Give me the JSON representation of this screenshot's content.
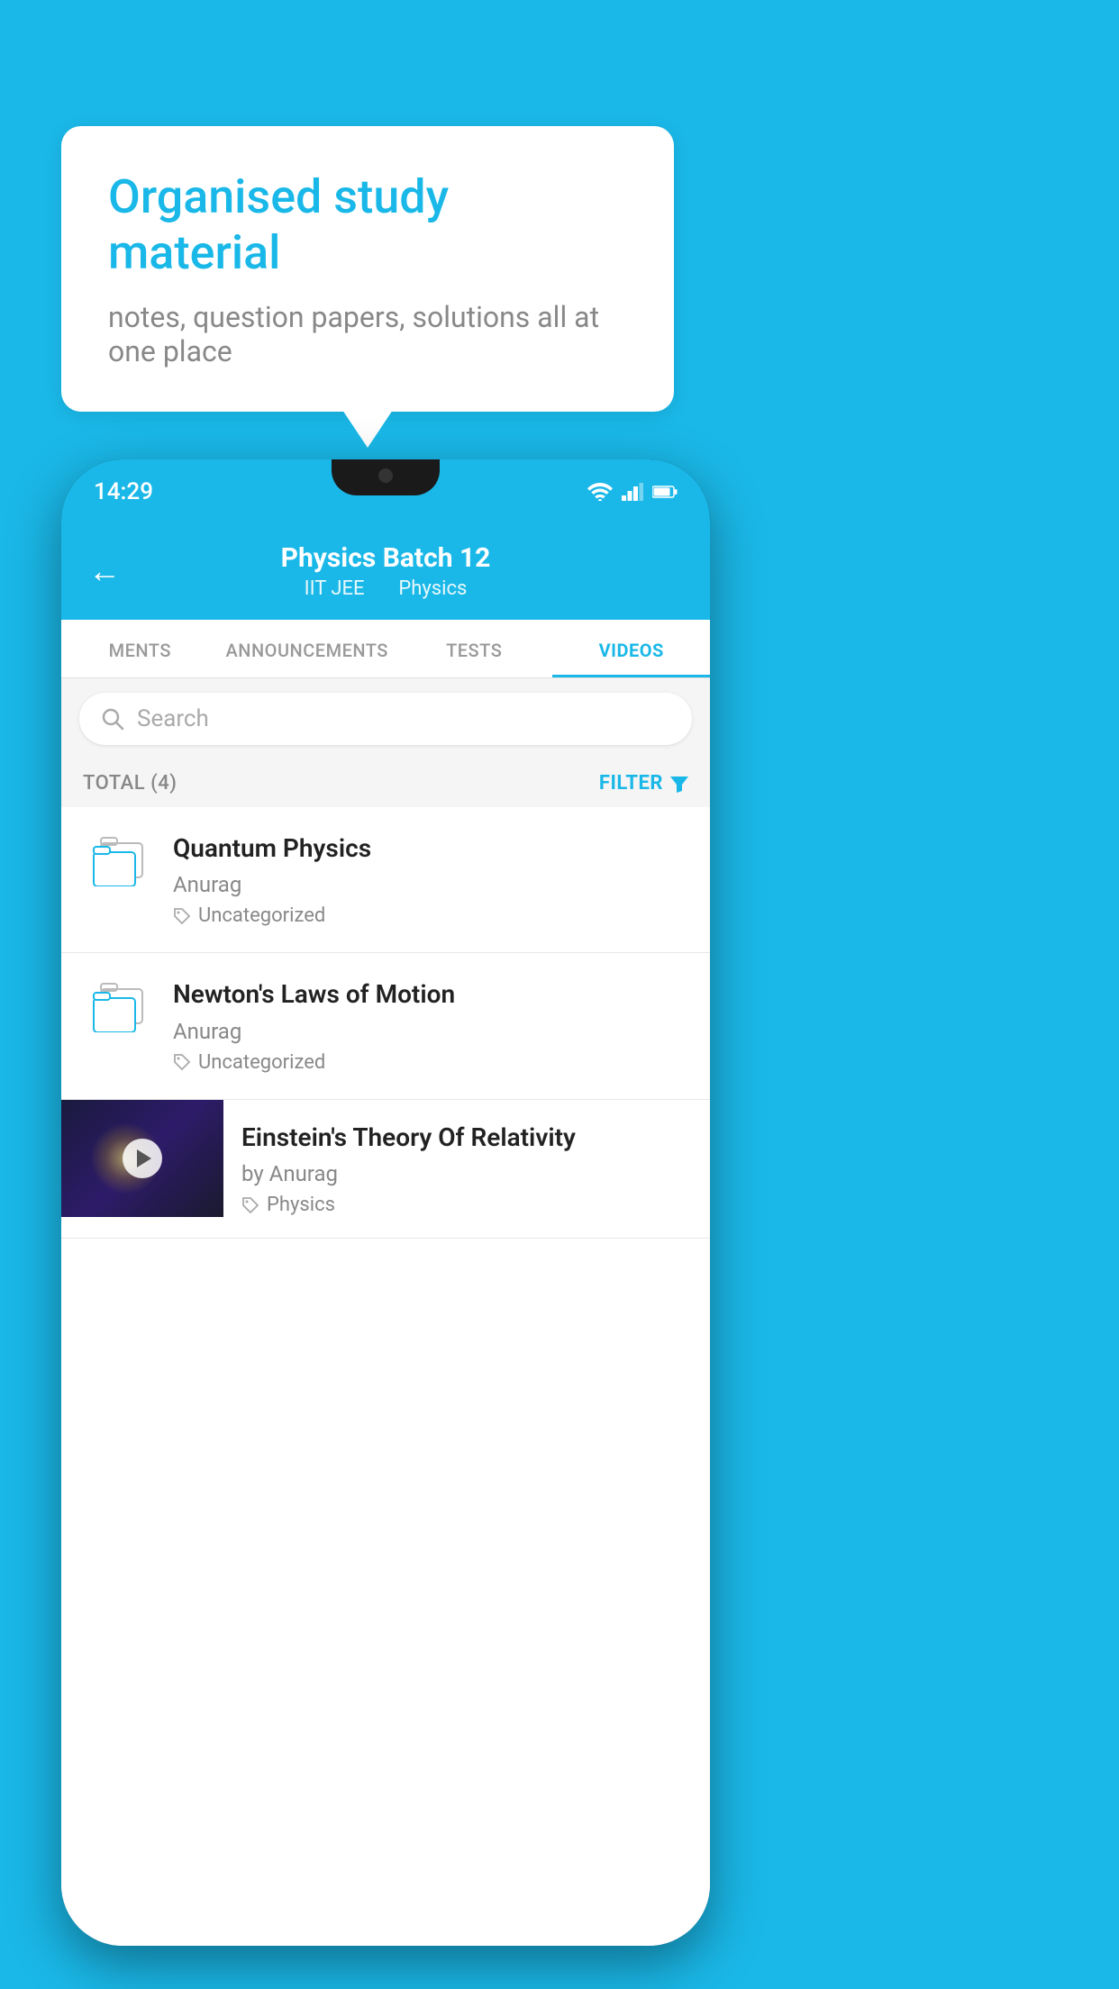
{
  "background_color": "#1ab8e8",
  "speech_bubble": {
    "title": "Organised study material",
    "subtitle": "notes, question papers, solutions all at one place"
  },
  "phone": {
    "status_bar": {
      "time": "14:29"
    },
    "header": {
      "title": "Physics Batch 12",
      "subtitle_part1": "IIT JEE",
      "subtitle_part2": "Physics",
      "back_label": "←"
    },
    "tabs": [
      {
        "label": "MENTS",
        "active": false
      },
      {
        "label": "ANNOUNCEMENTS",
        "active": false
      },
      {
        "label": "TESTS",
        "active": false
      },
      {
        "label": "VIDEOS",
        "active": true
      }
    ],
    "search": {
      "placeholder": "Search"
    },
    "filter": {
      "total_label": "TOTAL (4)",
      "filter_label": "FILTER"
    },
    "videos": [
      {
        "type": "folder",
        "title": "Quantum Physics",
        "author": "Anurag",
        "tag": "Uncategorized"
      },
      {
        "type": "folder",
        "title": "Newton's Laws of Motion",
        "author": "Anurag",
        "tag": "Uncategorized"
      },
      {
        "type": "video",
        "title": "Einstein's Theory Of Relativity",
        "author": "by Anurag",
        "tag": "Physics"
      }
    ]
  }
}
